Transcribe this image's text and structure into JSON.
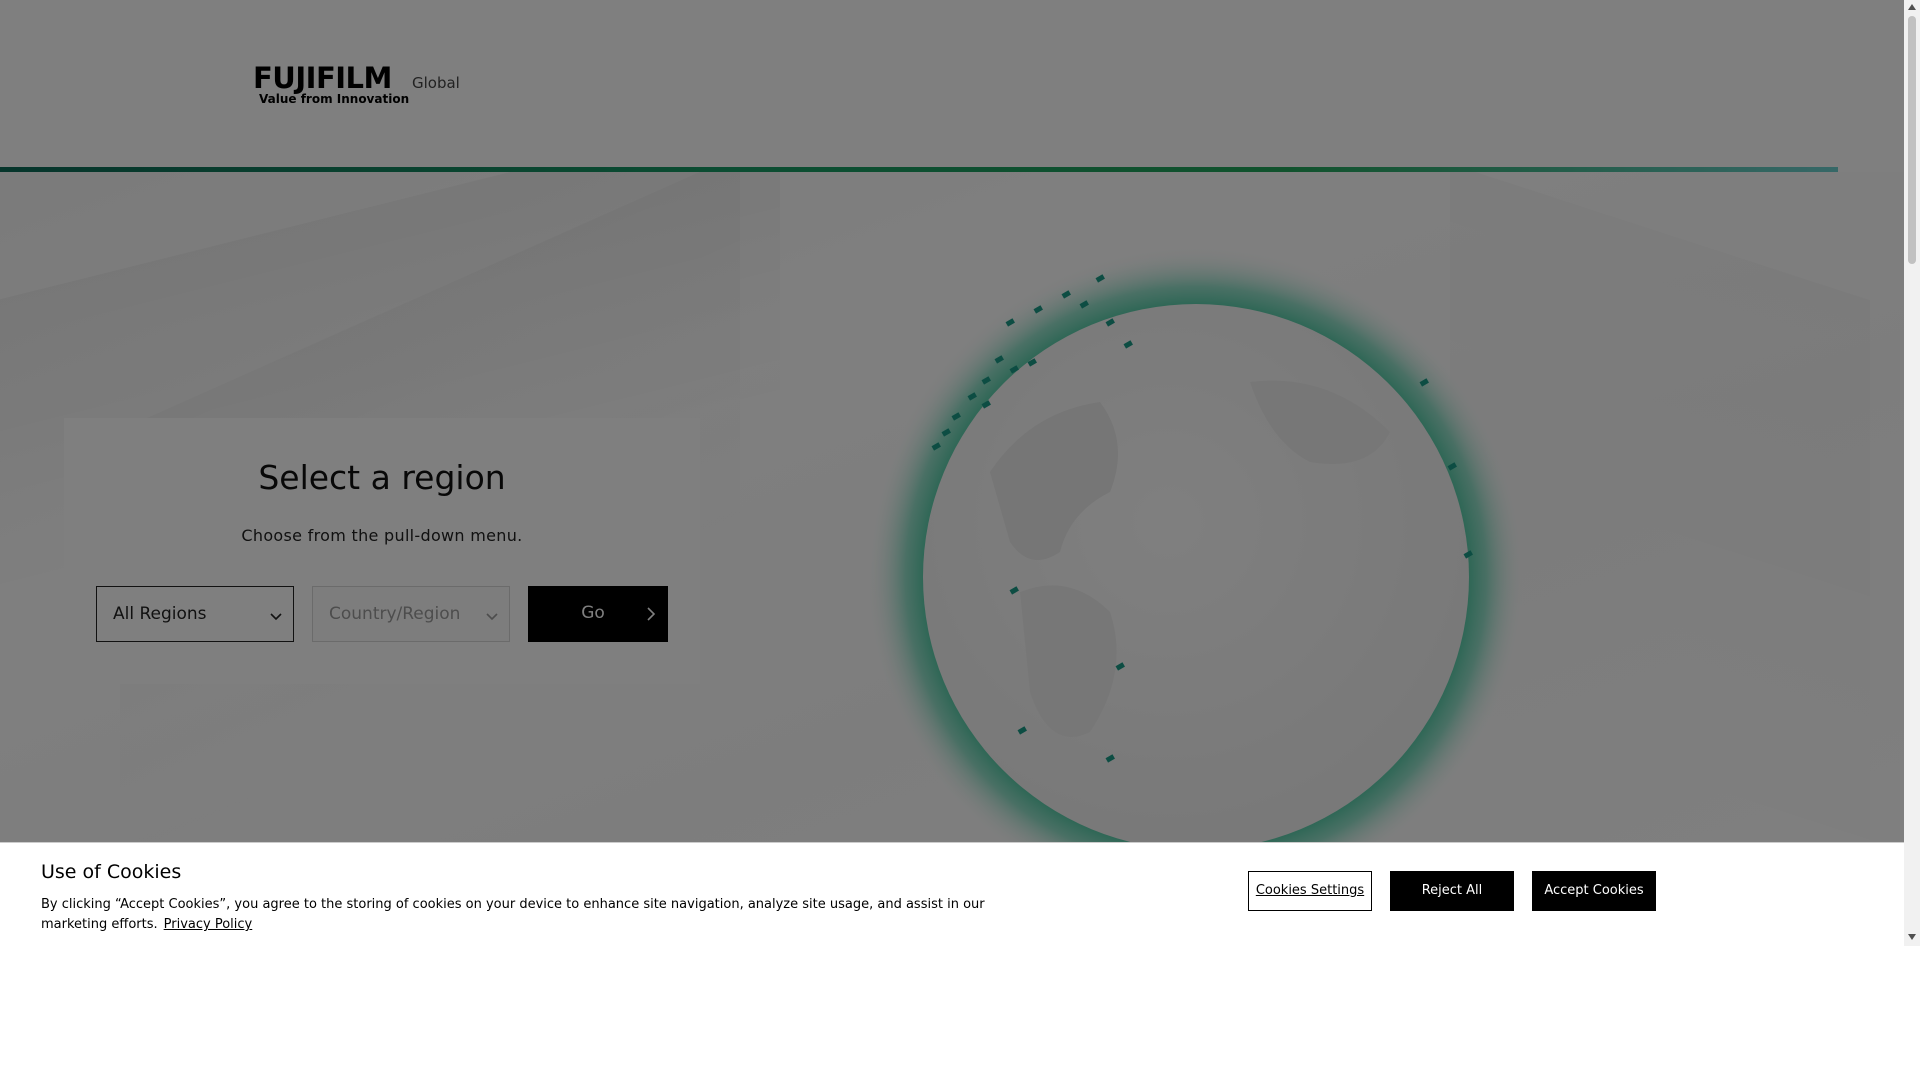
{
  "header": {
    "logo_wordmark": "FUJIFILM",
    "logo_tagline": "Value from Innovation",
    "site_label": "Global"
  },
  "region_selector": {
    "title": "Select a region",
    "subtitle": "Choose from the pull-down menu.",
    "region_select_value": "All Regions",
    "country_select_placeholder": "Country/Region",
    "go_label": "Go"
  },
  "cookie_banner": {
    "title": "Use of Cookies",
    "body": "By clicking “Accept Cookies”, you agree to the storing of cookies on your device to enhance site navigation, analyze site usage, and assist in our marketing efforts.",
    "privacy_link": "Privacy Policy",
    "settings_label": "Cookies Settings",
    "reject_label": "Reject All",
    "accept_label": "Accept Cookies"
  },
  "colors": {
    "accent_green": "#179a64",
    "accent_teal": "#6ed0cf",
    "brand_red": "#e60012",
    "overlay": "rgba(0,0,0,0.5)"
  },
  "icons": {
    "select_chevron": "chevron-down-icon",
    "go_chevron": "chevron-right-icon",
    "globe": "globe-map-icon"
  }
}
